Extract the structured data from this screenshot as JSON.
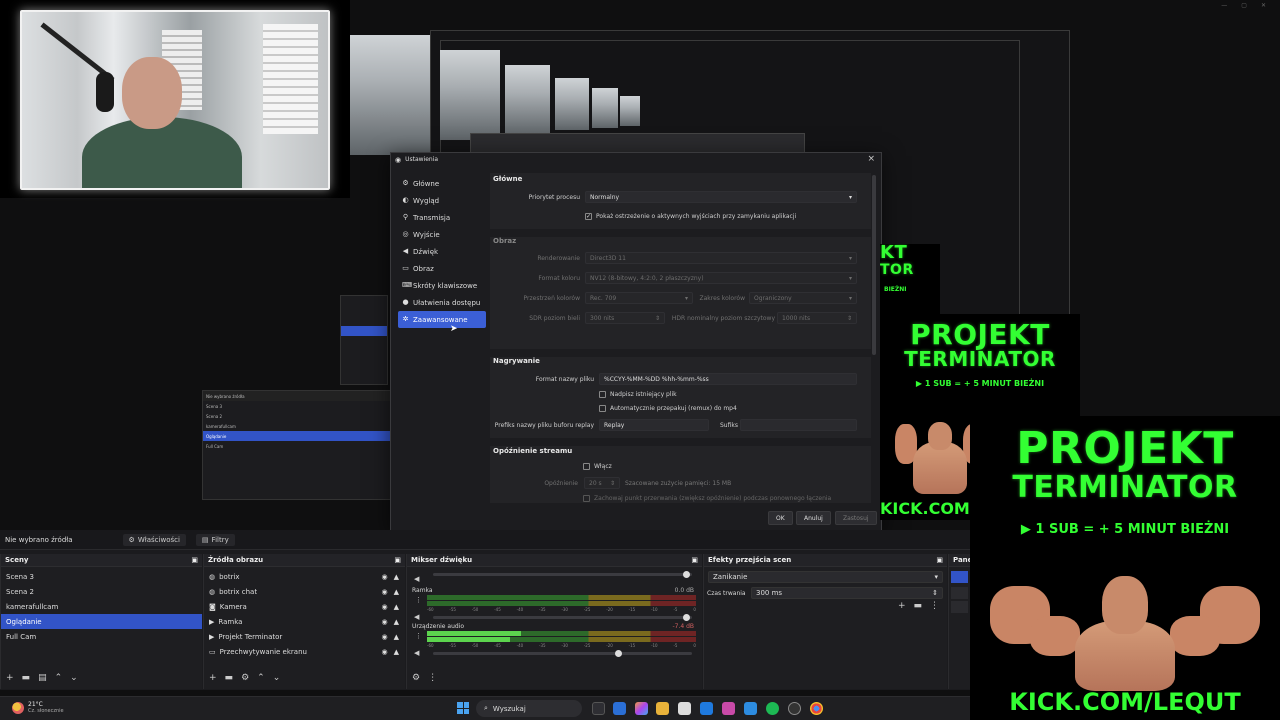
{
  "settings": {
    "window_title": "Ustawienia",
    "close": "×",
    "sidebar": [
      {
        "label": "Główne",
        "icon": "gear-icon"
      },
      {
        "label": "Wygląd",
        "icon": "palette-icon"
      },
      {
        "label": "Transmisja",
        "icon": "antenna-icon"
      },
      {
        "label": "Wyjście",
        "icon": "output-icon"
      },
      {
        "label": "Dźwięk",
        "icon": "speaker-icon"
      },
      {
        "label": "Obraz",
        "icon": "monitor-icon"
      },
      {
        "label": "Skróty klawiszowe",
        "icon": "keyboard-icon"
      },
      {
        "label": "Ułatwienia dostępu",
        "icon": "accessibility-icon"
      },
      {
        "label": "Zaawansowane",
        "icon": "wrench-icon"
      }
    ],
    "selected_index": 8,
    "general": {
      "heading": "Główne",
      "priority_label": "Priorytet procesu",
      "priority_value": "Normalny",
      "warn_checkbox": "Pokaż ostrzeżenie o aktywnych wyjściach przy zamykaniu aplikacji"
    },
    "video": {
      "heading": "Obraz",
      "renderer_label": "Renderowanie",
      "renderer_value": "Direct3D 11",
      "color_format_label": "Format koloru",
      "color_format_value": "NV12 (8-bitowy, 4:2:0, 2 płaszczyzny)",
      "color_space_label": "Przestrzeń kolorów",
      "color_space_value": "Rec. 709",
      "color_range_label": "Zakres kolorów",
      "color_range_value": "Ograniczony",
      "sdr_label": "SDR poziom bieli",
      "sdr_value": "300 nits",
      "hdr_label": "HDR nominalny poziom szczytowy",
      "hdr_value": "1000 nits"
    },
    "recording": {
      "heading": "Nagrywanie",
      "filename_label": "Format nazwy pliku",
      "filename_value": "%CCYY-%MM-%DD %hh-%mm-%ss",
      "overwrite": "Nadpisz istniejący plik",
      "remux": "Automatycznie przepakuj (remux) do mp4",
      "replay_prefix_label": "Prefiks nazwy pliku buforu replay",
      "replay_prefix_value": "Replay",
      "suffix_label": "Sufiks"
    },
    "stream_delay": {
      "heading": "Opóźnienie streamu",
      "enable": "Włącz",
      "delay_label": "Opóźnienie",
      "delay_value": "20 s",
      "memory_est": "Szacowane zużycie pamięci: 15 MB",
      "preserve": "Zachowaj punkt przerwania (zwiększ opóźnienie) podczas ponownego łączenia"
    },
    "buttons": {
      "ok": "OK",
      "cancel": "Anuluj",
      "apply": "Zastosuj"
    }
  },
  "main": {
    "no_source": "Nie wybrano źródła",
    "properties": "Właściwości",
    "filters": "Filtry",
    "scenes_title": "Sceny",
    "scenes": [
      "Scena 3",
      "Scena 2",
      "kamerafullcam",
      "Oglądanie",
      "Full Cam"
    ],
    "selected_scene": 3,
    "sources_title": "Źródła obrazu",
    "sources": [
      {
        "name": "botrix",
        "icon": "browser-icon"
      },
      {
        "name": "botrix chat",
        "icon": "browser-icon"
      },
      {
        "name": "Kamera",
        "icon": "camera-icon"
      },
      {
        "name": "Ramka",
        "icon": "play-icon"
      },
      {
        "name": "Projekt Terminator",
        "icon": "play-icon"
      },
      {
        "name": "Przechwytywanie ekranu",
        "icon": "monitor-icon"
      }
    ],
    "mixer_title": "Mikser dźwięku",
    "mixer": [
      {
        "name": "Ramka",
        "db": "0.0 dB",
        "level": 0.0,
        "volume": 0.98
      },
      {
        "name": "Urządzenie audio",
        "db": "-7.4 dB",
        "level": 0.35,
        "volume": 0.72
      }
    ],
    "meter_scale": [
      "-60",
      "-55",
      "-50",
      "-45",
      "-40",
      "-35",
      "-30",
      "-25",
      "-20",
      "-15",
      "-10",
      "-5",
      "0"
    ],
    "transitions_title": "Efekty przejścia scen",
    "transition_value": "Zanikanie",
    "duration_label": "Czas trwania",
    "duration_value": "300 ms",
    "panel_title": "Pane"
  },
  "taskbar": {
    "temp": "21°C",
    "weather": "Cz. słonecznie",
    "search": "Wyszukaj"
  },
  "promo": {
    "title1": "PROJEKT",
    "title2": "TERMINATOR",
    "sub": "▶ 1 SUB = + 5 MINUT BIEŻNI",
    "link": "KICK.COM/LEQUT",
    "link_partial": "KICK.COM",
    "partial_title": "KT",
    "partial_title2": "TOR",
    "partial_sub": "BIEŻNI"
  },
  "colors": {
    "accent": "#3b5fd6",
    "promo_green": "#33ff33"
  }
}
